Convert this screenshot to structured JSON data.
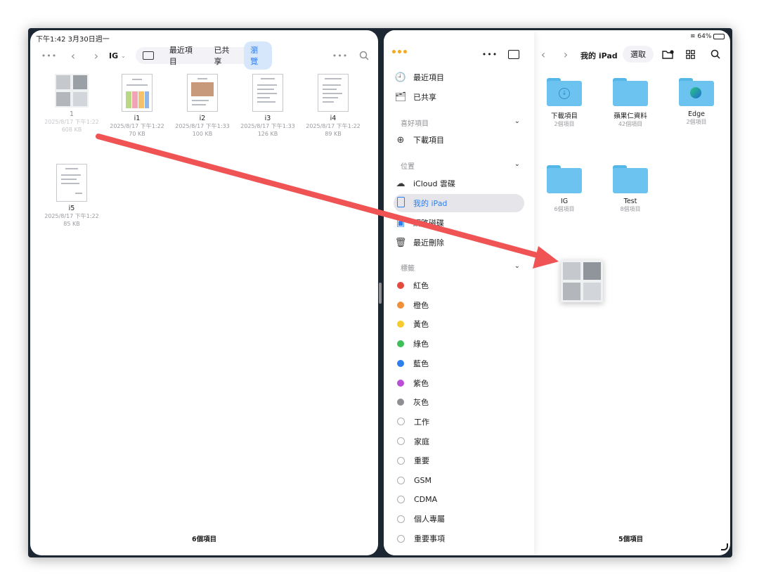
{
  "left": {
    "status_time": "下午1:42  3月30日週一",
    "location": "IG",
    "tabs": [
      "最近項目",
      "已共享",
      "瀏覽"
    ],
    "active_tab": "瀏覽",
    "files": [
      {
        "name": "1",
        "date": "2025/8/17 下午1:22",
        "size": "608 KB"
      },
      {
        "name": "i1",
        "date": "2025/8/17 下午1:22",
        "size": "70 KB"
      },
      {
        "name": "i2",
        "date": "2025/8/17 下午1:33",
        "size": "100 KB"
      },
      {
        "name": "i3",
        "date": "2025/8/17 下午1:33",
        "size": "126 KB"
      },
      {
        "name": "i4",
        "date": "2025/8/17 下午1:22",
        "size": "89 KB"
      },
      {
        "name": "i5",
        "date": "2025/8/17 下午1:22",
        "size": "85 KB"
      }
    ],
    "footer": "6個項目"
  },
  "right": {
    "battery": "64%",
    "title": "我的 iPad",
    "select_label": "選取",
    "sidebar": {
      "top_items": [
        {
          "label": "最近項目",
          "icon": "clock-icon"
        },
        {
          "label": "已共享",
          "icon": "shared-folder-icon"
        }
      ],
      "favorites_header": "喜好項目",
      "favorites": [
        {
          "label": "下載項目",
          "icon": "download-icon"
        }
      ],
      "locations_header": "位置",
      "locations": [
        {
          "label": "iCloud 雲碟",
          "icon": "cloud-icon"
        },
        {
          "label": "我的 iPad",
          "icon": "ipad-icon"
        },
        {
          "label": "網路磁碟",
          "icon": "drive-icon"
        },
        {
          "label": "最近刪除",
          "icon": "trash-icon"
        }
      ],
      "tags_header": "標籤",
      "tags": [
        {
          "label": "紅色",
          "color": "#e5493f"
        },
        {
          "label": "橙色",
          "color": "#f0903a"
        },
        {
          "label": "黃色",
          "color": "#f5cc2b"
        },
        {
          "label": "綠色",
          "color": "#3fbf5a"
        },
        {
          "label": "藍色",
          "color": "#2d7ff0"
        },
        {
          "label": "紫色",
          "color": "#b84fd6"
        },
        {
          "label": "灰色",
          "color": "#8e8e93"
        },
        {
          "label": "工作",
          "color": ""
        },
        {
          "label": "家庭",
          "color": ""
        },
        {
          "label": "重要",
          "color": ""
        },
        {
          "label": "GSM",
          "color": ""
        },
        {
          "label": "CDMA",
          "color": ""
        },
        {
          "label": "個人專屬",
          "color": ""
        },
        {
          "label": "重要事項",
          "color": ""
        }
      ]
    },
    "folders": [
      {
        "name": "下載項目",
        "meta": "2個項目"
      },
      {
        "name": "蘋果仁資料",
        "meta": "42個項目"
      },
      {
        "name": "Edge",
        "meta": "2個項目"
      },
      {
        "name": "IG",
        "meta": "6個項目"
      },
      {
        "name": "Test",
        "meta": "8個項目"
      }
    ],
    "footer": "5個項目"
  },
  "colors": {
    "accent": "#2d7ff0",
    "folder": "#6cc3ef",
    "arrow": "#ef5353"
  }
}
